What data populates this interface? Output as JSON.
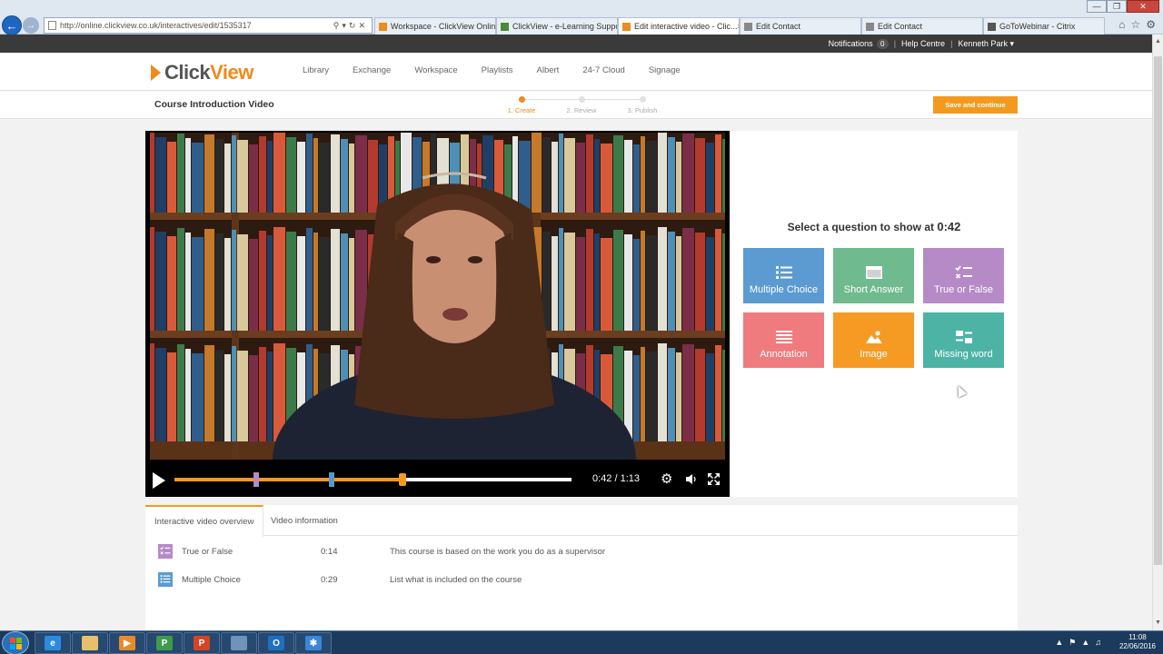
{
  "browser": {
    "url": "http://online.clickview.co.uk/interactives/edit/1535317",
    "tabs": [
      {
        "label": "Workspace - ClickView Online",
        "icon": "clickview-favicon",
        "color": "#f08a1c",
        "active": false
      },
      {
        "label": "ClickView - e-Learning Support",
        "icon": "support-favicon",
        "color": "#4a8a3a",
        "active": false
      },
      {
        "label": "Edit interactive video - Clic...",
        "icon": "clickview-favicon",
        "color": "#f08a1c",
        "active": true
      },
      {
        "label": "Edit Contact",
        "icon": "page-favicon",
        "color": "#888888",
        "active": false
      },
      {
        "label": "Edit Contact",
        "icon": "page-favicon",
        "color": "#888888",
        "active": false
      },
      {
        "label": "GoToWebinar - Citrix",
        "icon": "gotowebinar-favicon",
        "color": "#555555",
        "active": false
      }
    ]
  },
  "utility": {
    "notifications_label": "Notifications",
    "notifications_count": "0",
    "help_label": "Help Centre",
    "user_name": "Kenneth Park"
  },
  "header": {
    "logo_click": "Click",
    "logo_view": "View",
    "nav": [
      "Library",
      "Exchange",
      "Workspace",
      "Playlists",
      "Albert",
      "24-7 Cloud",
      "Signage"
    ]
  },
  "subheader": {
    "title": "Course Introduction Video",
    "steps": [
      {
        "label": "1. Create",
        "active": true
      },
      {
        "label": "2. Review",
        "active": false
      },
      {
        "label": "3. Publish",
        "active": false
      }
    ],
    "save_label": "Save and continue"
  },
  "player": {
    "current_time": "0:42",
    "duration": "1:13",
    "progress_fraction": 0.575,
    "markers": [
      {
        "fraction": 0.205,
        "color": "#b58ac7",
        "type": "True or False"
      },
      {
        "fraction": 0.397,
        "color": "#5c97c9",
        "type": "Multiple Choice"
      }
    ]
  },
  "panel": {
    "heading_prefix": "Select a question to show at",
    "heading_time": "0:42",
    "questions": [
      {
        "label": "Multiple Choice",
        "color": "#5b9bd1",
        "icon": "list-icon"
      },
      {
        "label": "Short Answer",
        "color": "#6fba8e",
        "icon": "short-answer-icon"
      },
      {
        "label": "True or False",
        "color": "#b58ac7",
        "icon": "true-false-icon"
      },
      {
        "label": "Annotation",
        "color": "#ef7b7e",
        "icon": "annotation-icon"
      },
      {
        "label": "Image",
        "color": "#f59b24",
        "icon": "image-icon"
      },
      {
        "label": "Missing word",
        "color": "#4db3a4",
        "icon": "missing-word-icon"
      }
    ]
  },
  "overview": {
    "tabs": [
      "Interactive video overview",
      "Video information"
    ],
    "rows": [
      {
        "type": "True or False",
        "time": "0:14",
        "text": "This course is based on the work you do as a supervisor",
        "color": "#b58ac7",
        "icon": "true-false-icon"
      },
      {
        "type": "Multiple Choice",
        "time": "0:29",
        "text": "List what is included on the course",
        "color": "#5b9bd1",
        "icon": "list-icon"
      }
    ]
  },
  "taskbar": {
    "apps": [
      {
        "name": "internet-explorer",
        "color": "#2b8be0",
        "glyph": "e"
      },
      {
        "name": "file-explorer",
        "color": "#e6c06a",
        "glyph": ""
      },
      {
        "name": "media-player",
        "color": "#e88a2c",
        "glyph": "▶"
      },
      {
        "name": "project",
        "color": "#3e9b4b",
        "glyph": "P"
      },
      {
        "name": "powerpoint",
        "color": "#d24625",
        "glyph": "P"
      },
      {
        "name": "remote-desktop",
        "color": "#6f93b9",
        "glyph": ""
      },
      {
        "name": "outlook",
        "color": "#1f6fc1",
        "glyph": "O"
      },
      {
        "name": "snowflake-app",
        "color": "#3a86d8",
        "glyph": "✱"
      }
    ],
    "time": "11:08",
    "date": "22/06/2016"
  }
}
